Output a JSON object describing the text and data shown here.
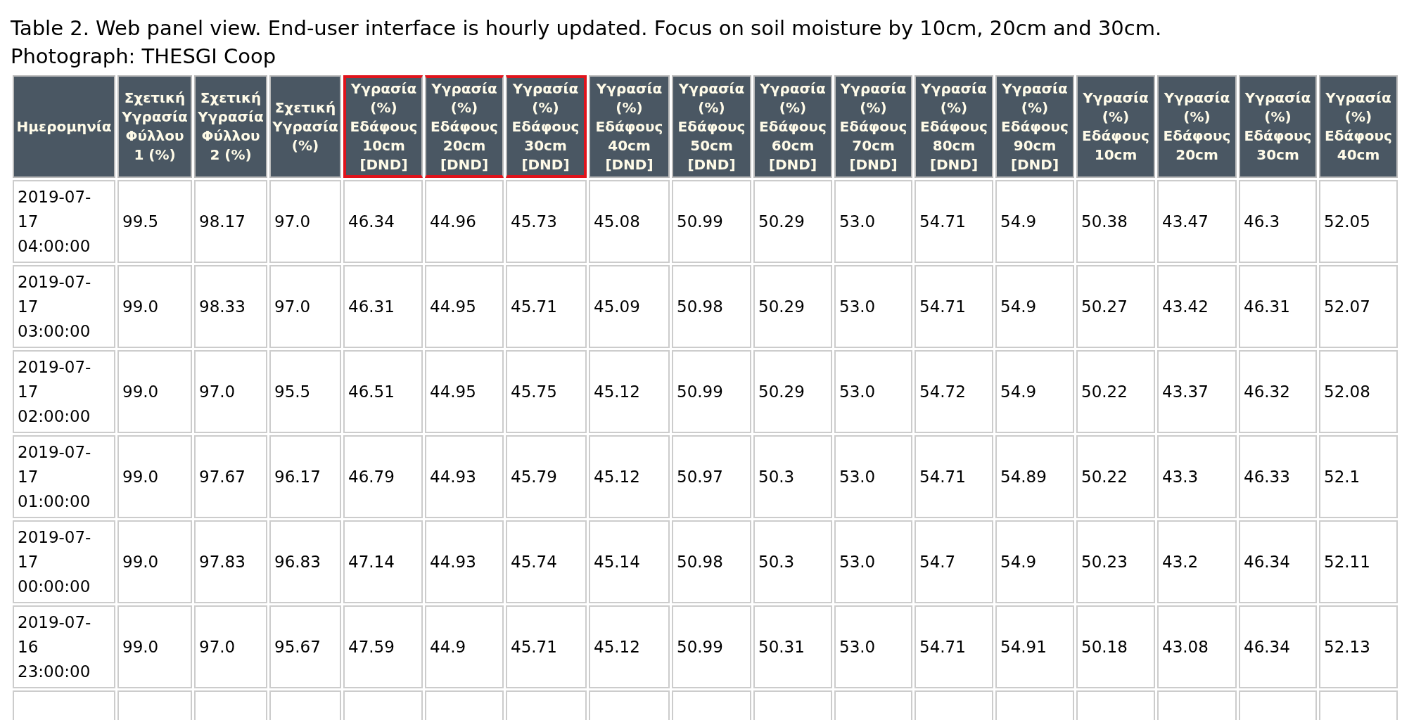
{
  "caption": [
    "Table 2. Web panel view. End-user interface is hourly updated. Focus on soil moisture by 10cm, 20cm and 30cm.",
    "Photograph: THESGI Coop"
  ],
  "table": {
    "columns": [
      {
        "label": "Ημερομηνία",
        "highlighted": false
      },
      {
        "label": "Σχετική Υγρασία Φύλλου 1 (%)",
        "highlighted": false
      },
      {
        "label": "Σχετική Υγρασία Φύλλου 2 (%)",
        "highlighted": false
      },
      {
        "label": "Σχετική Υγρασία (%)",
        "highlighted": false
      },
      {
        "label": "Υγρασία (%) Εδάφους 10cm [DND]",
        "highlighted": true
      },
      {
        "label": "Υγρασία (%) Εδάφους 20cm [DND]",
        "highlighted": true
      },
      {
        "label": "Υγρασία (%) Εδάφους 30cm [DND]",
        "highlighted": true
      },
      {
        "label": "Υγρασία (%) Εδάφους 40cm [DND]",
        "highlighted": false
      },
      {
        "label": "Υγρασία (%) Εδάφους 50cm [DND]",
        "highlighted": false
      },
      {
        "label": "Υγρασία (%) Εδάφους 60cm [DND]",
        "highlighted": false
      },
      {
        "label": "Υγρασία (%) Εδάφους 70cm [DND]",
        "highlighted": false
      },
      {
        "label": "Υγρασία (%) Εδάφους 80cm [DND]",
        "highlighted": false
      },
      {
        "label": "Υγρασία (%) Εδάφους 90cm [DND]",
        "highlighted": false
      },
      {
        "label": "Υγρασία (%) Εδάφους 10cm",
        "highlighted": false
      },
      {
        "label": "Υγρασία (%) Εδάφους 20cm",
        "highlighted": false
      },
      {
        "label": "Υγρασία (%) Εδάφους 30cm",
        "highlighted": false
      },
      {
        "label": "Υγρασία (%) Εδάφους 40cm",
        "highlighted": false
      }
    ],
    "rows": [
      [
        "2019-07-17 04:00:00",
        "99.5",
        "98.17",
        "97.0",
        "46.34",
        "44.96",
        "45.73",
        "45.08",
        "50.99",
        "50.29",
        "53.0",
        "54.71",
        "54.9",
        "50.38",
        "43.47",
        "46.3",
        "52.05"
      ],
      [
        "2019-07-17 03:00:00",
        "99.0",
        "98.33",
        "97.0",
        "46.31",
        "44.95",
        "45.71",
        "45.09",
        "50.98",
        "50.29",
        "53.0",
        "54.71",
        "54.9",
        "50.27",
        "43.42",
        "46.31",
        "52.07"
      ],
      [
        "2019-07-17 02:00:00",
        "99.0",
        "97.0",
        "95.5",
        "46.51",
        "44.95",
        "45.75",
        "45.12",
        "50.99",
        "50.29",
        "53.0",
        "54.72",
        "54.9",
        "50.22",
        "43.37",
        "46.32",
        "52.08"
      ],
      [
        "2019-07-17 01:00:00",
        "99.0",
        "97.67",
        "96.17",
        "46.79",
        "44.93",
        "45.79",
        "45.12",
        "50.97",
        "50.3",
        "53.0",
        "54.71",
        "54.89",
        "50.22",
        "43.3",
        "46.33",
        "52.1"
      ],
      [
        "2019-07-17 00:00:00",
        "99.0",
        "97.83",
        "96.83",
        "47.14",
        "44.93",
        "45.74",
        "45.14",
        "50.98",
        "50.3",
        "53.0",
        "54.7",
        "54.9",
        "50.23",
        "43.2",
        "46.34",
        "52.11"
      ],
      [
        "2019-07-16 23:00:00",
        "99.0",
        "97.0",
        "95.67",
        "47.59",
        "44.9",
        "45.71",
        "45.12",
        "50.99",
        "50.31",
        "53.0",
        "54.71",
        "54.91",
        "50.18",
        "43.08",
        "46.34",
        "52.13"
      ]
    ]
  }
}
